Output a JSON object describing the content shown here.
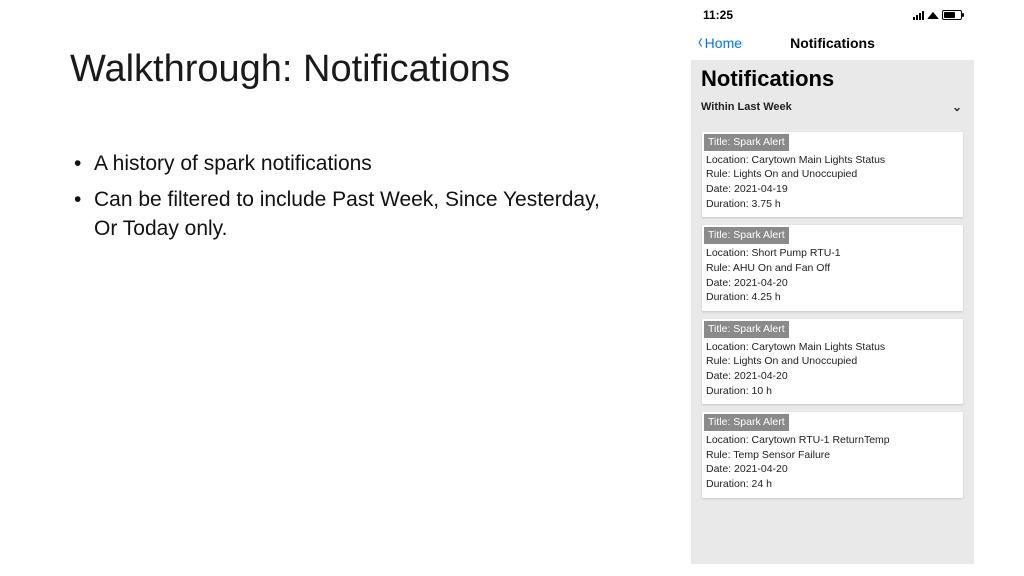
{
  "slide": {
    "title": "Walkthrough: Notifications",
    "bullets": [
      "A history of spark notifications",
      "Can be filtered to include Past Week, Since Yesterday, Or Today only."
    ]
  },
  "phone": {
    "status_time": "11:25",
    "nav_back_label": "Home",
    "nav_title": "Notifications",
    "page_title": "Notifications",
    "filter_label": "Within Last Week",
    "title_prefix": "Title: ",
    "location_prefix": "Location:  ",
    "rule_prefix": "Rule:  ",
    "date_prefix": "Date: ",
    "duration_prefix": "Duration: ",
    "cards": [
      {
        "title": "Spark Alert",
        "location": "Carytown Main Lights Status",
        "rule": "Lights On and Unoccupied",
        "date": "2021-04-19",
        "duration": "3.75 h"
      },
      {
        "title": "Spark Alert",
        "location": "Short Pump RTU-1",
        "rule": "AHU On and Fan Off",
        "date": "2021-04-20",
        "duration": "4.25 h"
      },
      {
        "title": "Spark Alert",
        "location": "Carytown Main Lights Status",
        "rule": "Lights On and Unoccupied",
        "date": "2021-04-20",
        "duration": "10 h"
      },
      {
        "title": "Spark Alert",
        "location": "Carytown RTU-1 ReturnTemp",
        "rule": "Temp Sensor Failure",
        "date": "2021-04-20",
        "duration": "24 h"
      }
    ]
  }
}
